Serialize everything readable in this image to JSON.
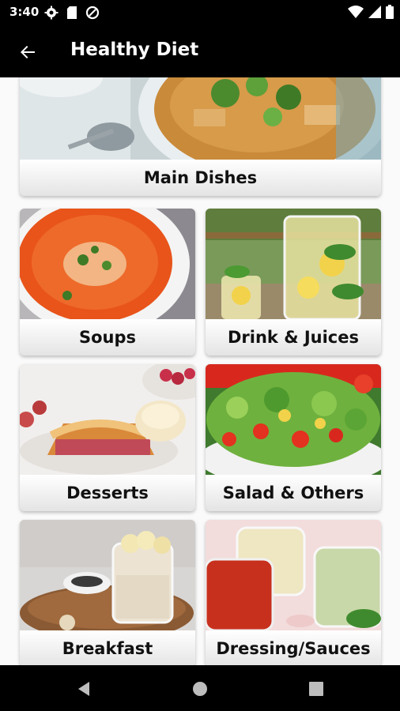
{
  "status": {
    "time": "3:40"
  },
  "app_bar": {
    "title": "Healthy Diet"
  },
  "categories": [
    {
      "label": "Main Dishes"
    },
    {
      "label": "Soups"
    },
    {
      "label": "Drink & Juices"
    },
    {
      "label": "Desserts"
    },
    {
      "label": "Salad & Others"
    },
    {
      "label": "Breakfast"
    },
    {
      "label": "Dressing/Sauces"
    }
  ]
}
